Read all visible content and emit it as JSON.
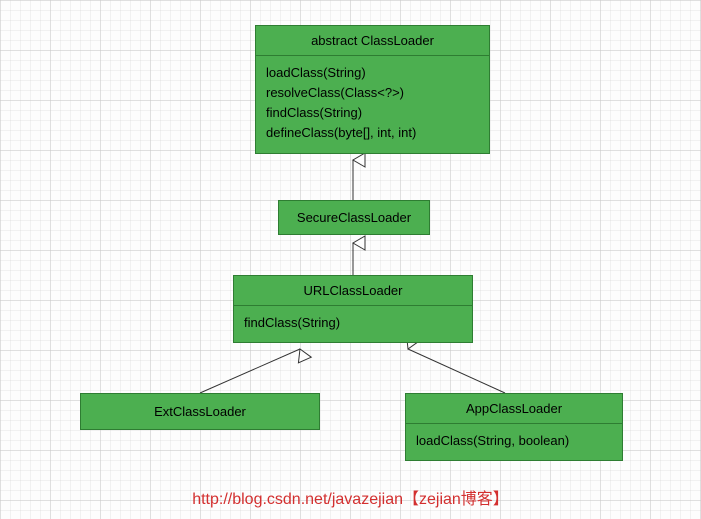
{
  "classes": {
    "classLoader": {
      "title": "abstract ClassLoader",
      "methods": [
        "loadClass(String)",
        "resolveClass(Class<?>)",
        "findClass(String)",
        "defineClass(byte[], int, int)"
      ]
    },
    "secureClassLoader": {
      "title": "SecureClassLoader"
    },
    "urlClassLoader": {
      "title": "URLClassLoader",
      "methods": [
        "findClass(String)"
      ]
    },
    "extClassLoader": {
      "title": "ExtClassLoader"
    },
    "appClassLoader": {
      "title": "AppClassLoader",
      "methods": [
        "loadClass(String, boolean)"
      ]
    }
  },
  "caption": {
    "url": "http://blog.csdn.net/javazejian",
    "tag": "【zejian博客】"
  }
}
